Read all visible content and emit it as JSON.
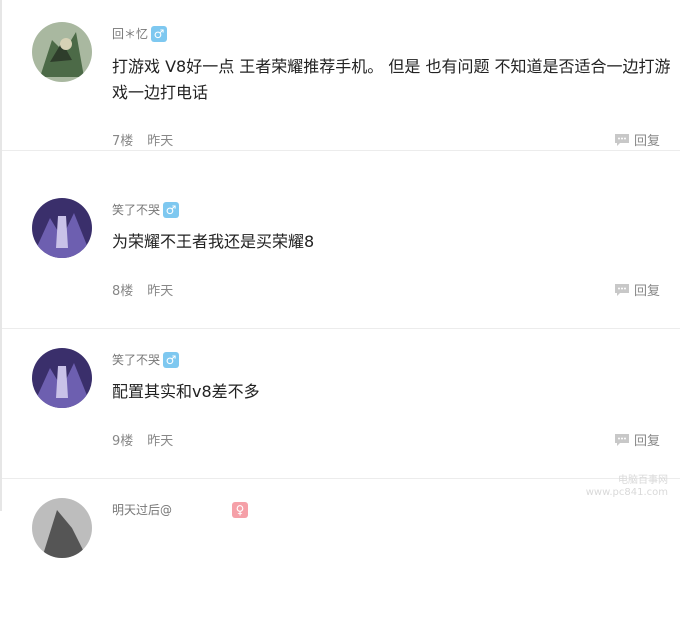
{
  "comments": [
    {
      "user": "回＊忆",
      "gender": "♂",
      "content": "打游戏  V8好一点  王者荣耀推荐手机。    但是  也有问题  不知道是否适合一边打游戏一边打电话",
      "floor": "7楼",
      "time": "昨天",
      "reply_label": "回复"
    },
    {
      "user": "笑了不哭",
      "gender": "♂",
      "content": "为荣耀不王者我还是买荣耀8",
      "floor": "8楼",
      "time": "昨天",
      "reply_label": "回复"
    },
    {
      "user": "笑了不哭",
      "gender": "♂",
      "content": "配置其实和v8差不多",
      "floor": "9楼",
      "time": "昨天",
      "reply_label": "回复"
    },
    {
      "user": "明天过后@",
      "gender": "♀"
    }
  ],
  "watermark": "电脑百事网\nwww.pc841.com",
  "colors": {
    "male_badge": "#7ec8f0",
    "female_badge": "#f5a0a8"
  }
}
